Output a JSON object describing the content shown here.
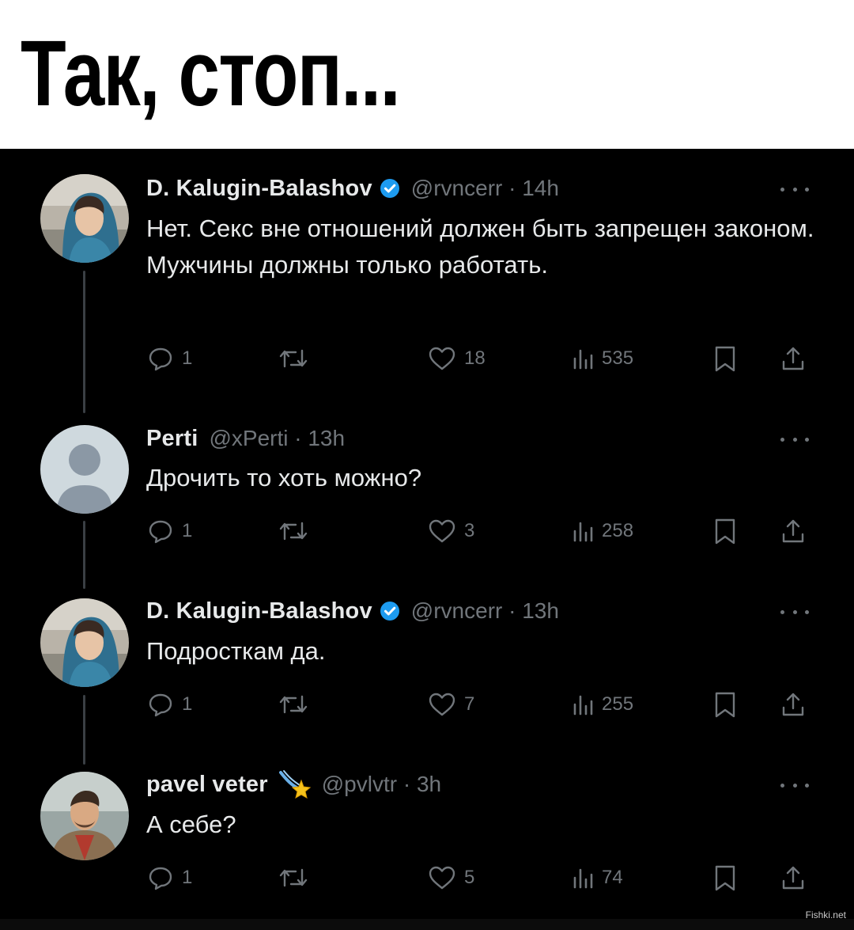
{
  "caption": "Так, стоп...",
  "watermark": "Fishki.net",
  "tweets": [
    {
      "name": "D. Kalugin-Balashov",
      "verified": true,
      "handle_time": "@rvncerr · 14h",
      "text": "Нет. Секс вне отношений должен быть запрещен законом. Мужчины должны только работать.",
      "replies": "1",
      "likes": "18",
      "views": "535"
    },
    {
      "name": "Perti",
      "verified": false,
      "handle_time": "@xPerti · 13h",
      "text": "Дрочить то хоть можно?",
      "replies": "1",
      "likes": "3",
      "views": "258"
    },
    {
      "name": "D. Kalugin-Balashov",
      "verified": true,
      "handle_time": "@rvncerr · 13h",
      "text": "Подросткам да.",
      "replies": "1",
      "likes": "7",
      "views": "255"
    },
    {
      "name": "pavel veter",
      "verified": false,
      "badge_icon": "shooting-star-emoji",
      "handle_time": "@pvlvtr · 3h",
      "text": "А себе?",
      "replies": "1",
      "likes": "5",
      "views": "74"
    }
  ],
  "colors": {
    "background": "#000000",
    "text": "#e7e9ea",
    "secondary_text": "#71767b",
    "verified_blue": "#1d9bf0"
  }
}
